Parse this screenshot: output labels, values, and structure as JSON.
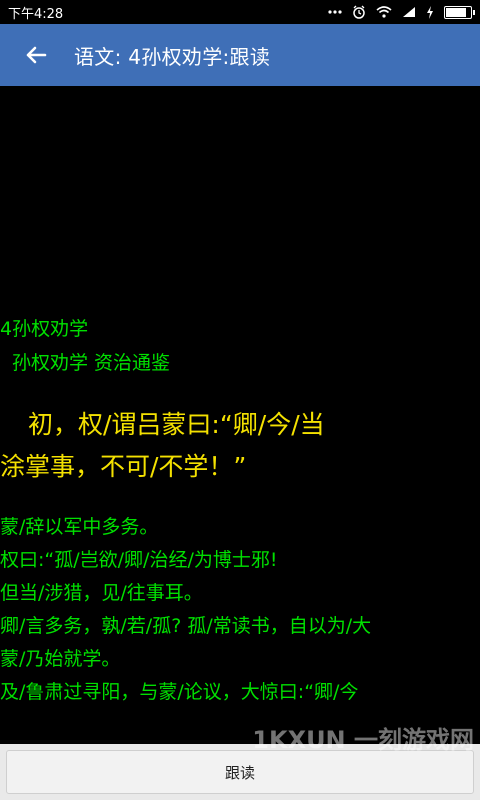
{
  "status_bar": {
    "time": "下午4:28",
    "battery_level": 0.9,
    "icons": [
      "dots-icon",
      "alarm-icon",
      "wifi-icon",
      "signal-icon",
      "charging-icon",
      "battery-icon"
    ]
  },
  "app_bar": {
    "back_icon": "arrow-left-icon",
    "title": "语文: 4孙权劝学:跟读",
    "color": "#3f6fb7"
  },
  "content": {
    "heading": "4孙权劝学",
    "subheading": "孙权劝学  资治通鉴",
    "focus_lines": [
      "初，权/谓吕蒙曰:“卿/今/当",
      "涂掌事，不可/不学！”"
    ],
    "body_lines": [
      "蒙/辞以军中多务。",
      "权曰:“孤/岂欲/卿/治经/为博士邪!",
      "但当/涉猎，见/往事耳。",
      "卿/言多务，孰/若/孤? 孤/常读书，自以为/大",
      "蒙/乃始就学。",
      "及/鲁肃过寻阳，与蒙/论议，大惊曰:“卿/今"
    ],
    "body_color": "#00e000",
    "focus_color": "#f4e100"
  },
  "bottom": {
    "follow_button_label": "跟读"
  },
  "watermark": "1KXUN 一刻游戏网"
}
